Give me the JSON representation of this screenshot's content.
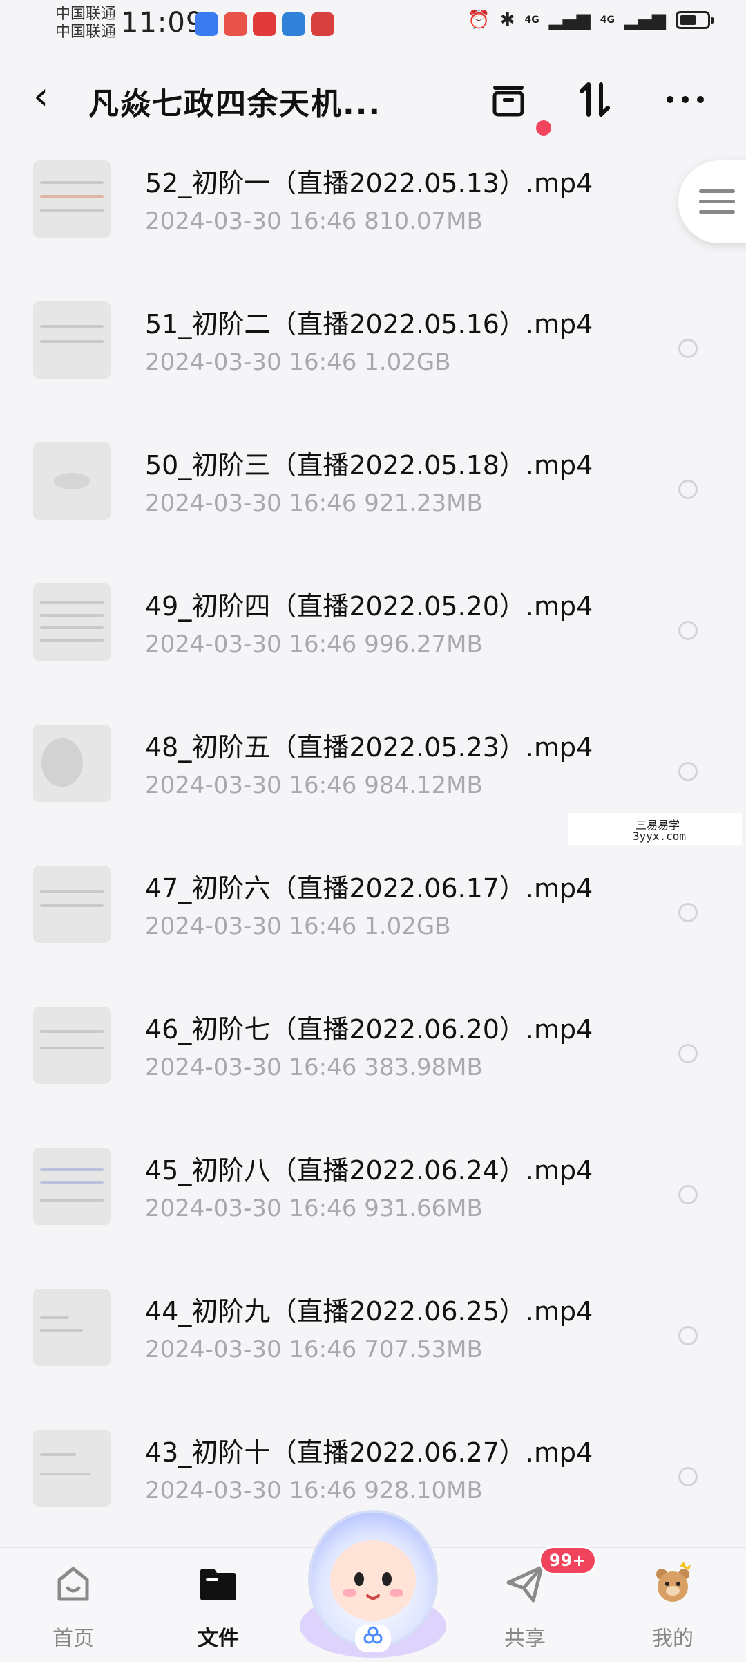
{
  "status_bar": {
    "carrier_1": "中国联通",
    "carrier_2": "中国联通",
    "time": "11:09",
    "network_1": "4G",
    "network_2": "4G"
  },
  "header": {
    "back_icon": "chevron-left-icon",
    "title": "凡焱七政四余天机...",
    "icons": [
      "archive-icon",
      "sort-icon",
      "more-icon"
    ]
  },
  "files": [
    {
      "name": "52_初阶一（直播2022.05.13）.mp4",
      "date": "2024-03-30",
      "time": "16:46",
      "size": "810.07MB"
    },
    {
      "name": "51_初阶二（直播2022.05.16）.mp4",
      "date": "2024-03-30",
      "time": "16:46",
      "size": "1.02GB"
    },
    {
      "name": "50_初阶三（直播2022.05.18）.mp4",
      "date": "2024-03-30",
      "time": "16:46",
      "size": "921.23MB"
    },
    {
      "name": "49_初阶四（直播2022.05.20）.mp4",
      "date": "2024-03-30",
      "time": "16:46",
      "size": "996.27MB"
    },
    {
      "name": "48_初阶五（直播2022.05.23）.mp4",
      "date": "2024-03-30",
      "time": "16:46",
      "size": "984.12MB"
    },
    {
      "name": "47_初阶六（直播2022.06.17）.mp4",
      "date": "2024-03-30",
      "time": "16:46",
      "size": "1.02GB"
    },
    {
      "name": "46_初阶七（直播2022.06.20）.mp4",
      "date": "2024-03-30",
      "time": "16:46",
      "size": "383.98MB"
    },
    {
      "name": "45_初阶八（直播2022.06.24）.mp4",
      "date": "2024-03-30",
      "time": "16:46",
      "size": "931.66MB"
    },
    {
      "name": "44_初阶九（直播2022.06.25）.mp4",
      "date": "2024-03-30",
      "time": "16:46",
      "size": "707.53MB"
    },
    {
      "name": "43_初阶十（直播2022.06.27）.mp4",
      "date": "2024-03-30",
      "time": "16:46",
      "size": "928.10MB"
    }
  ],
  "watermark": {
    "line1": "三易易学",
    "line2": "3yyx.com"
  },
  "bottom_nav": {
    "items": [
      {
        "label": "首页",
        "icon": "home-icon"
      },
      {
        "label": "文件",
        "icon": "folder-icon"
      },
      {
        "label": "共享",
        "icon": "share-icon"
      },
      {
        "label": "我的",
        "icon": "profile-bear-icon"
      }
    ],
    "badge": "99+"
  },
  "colors": {
    "accent": "#f0445c",
    "meta_text": "#a8a8ad",
    "background": "#f5f5f7"
  }
}
